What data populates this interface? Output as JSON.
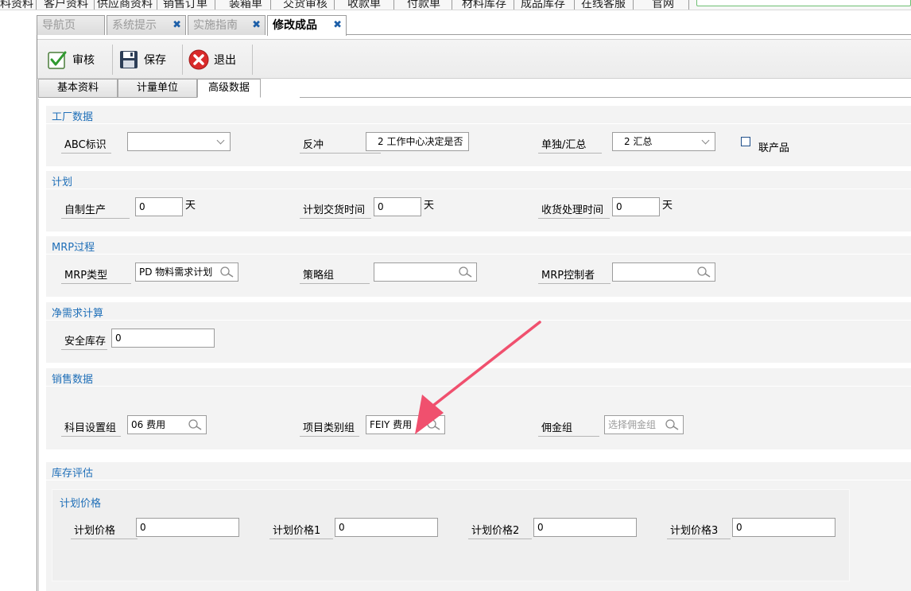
{
  "top_menu": {
    "items": [
      "料资料",
      "客户资料",
      "供应商资料",
      "销售订单",
      "装箱单",
      "交货审核",
      "收款单",
      "付款单",
      "材料库存",
      "成品库存",
      "在线客服",
      "官网"
    ]
  },
  "doc_tabs": [
    {
      "label": "导航页"
    },
    {
      "label": "系统提示"
    },
    {
      "label": "实施指南"
    },
    {
      "label": "修改成品"
    }
  ],
  "toolbar": {
    "approve_label": "审核",
    "save_label": "保存",
    "exit_label": "退出"
  },
  "sub_tabs": [
    {
      "label": "基本资料"
    },
    {
      "label": "计量单位"
    },
    {
      "label": "高级数据"
    }
  ],
  "factory": {
    "title": "工厂数据",
    "abc_label": "ABC标识",
    "abc_value": "",
    "backflush_label": "反冲",
    "backflush_value": "2 工作中心决定是否",
    "individual_label": "单独/汇总",
    "individual_value": "2 汇总",
    "coproduct_label": "联产品"
  },
  "plan": {
    "title": "计划",
    "inhouse_label": "自制生产",
    "inhouse_value": "0",
    "delivery_label": "计划交货时间",
    "delivery_value": "0",
    "gr_label": "收货处理时间",
    "gr_value": "0",
    "unit_day": "天"
  },
  "mrp": {
    "title": "MRP过程",
    "type_label": "MRP类型",
    "type_value": "PD 物料需求计划",
    "strategy_label": "策略组",
    "strategy_value": "",
    "controller_label": "MRP控制者",
    "controller_value": ""
  },
  "net_req": {
    "title": "净需求计算",
    "safety_label": "安全库存",
    "safety_value": "0"
  },
  "sales": {
    "title": "销售数据",
    "account_label": "科目设置组",
    "account_value": "06 费用",
    "item_cat_label": "项目类别组",
    "item_cat_value": "FEIY 费用",
    "commission_label": "佣金组",
    "commission_placeholder": "选择佣金组"
  },
  "valuation": {
    "title": "库存评估",
    "sub_title": "计划价格",
    "price_label": "计划价格",
    "price_value": "0",
    "price1_label": "计划价格1",
    "price1_value": "0",
    "price2_label": "计划价格2",
    "price2_value": "0",
    "price3_label": "计划价格3",
    "price3_value": "0"
  },
  "colors": {
    "section_title": "#1f6fb8",
    "tab_close": "#1d5fa8",
    "annotation_arrow": "#f0506e"
  }
}
